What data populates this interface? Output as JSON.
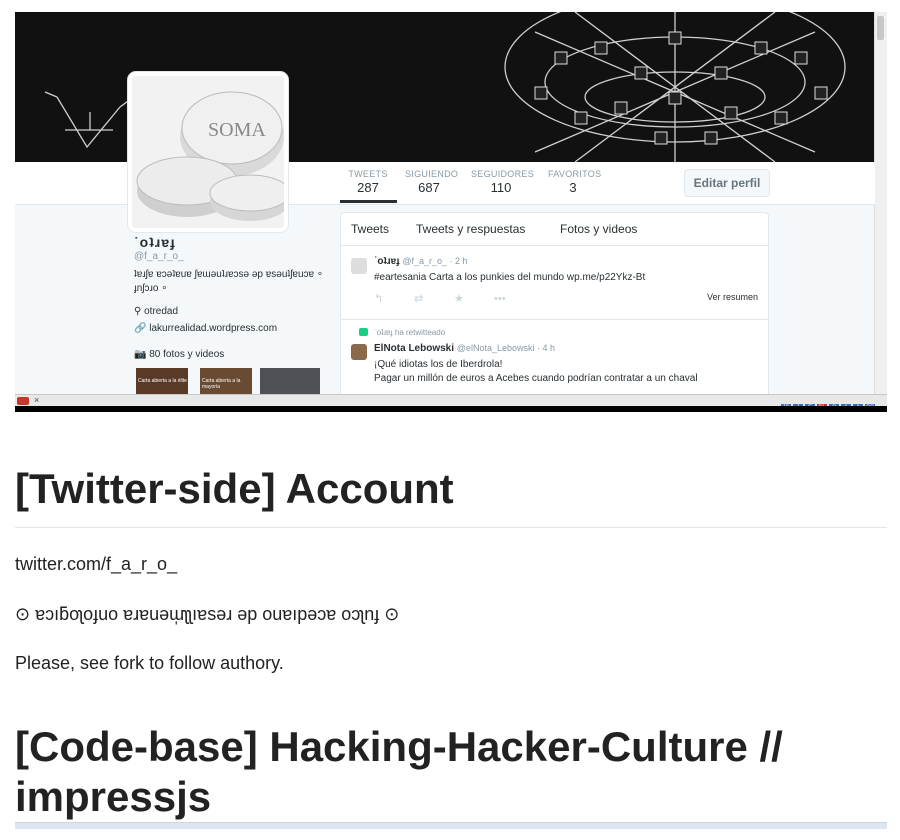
{
  "profile": {
    "name": "˙oʇɹɐɟ",
    "handle": "@f_a_r_o_",
    "bio": "ʇɐɹʃɐ ɐɔǝʇɐuɐ ʃɐɯǝuʇɹɐɔsǝ ǝp ɐsǝuʇʃɐuɔɐ ∘ ɟnʃɔɹo ∘",
    "location": "otredad",
    "link": "lakurrealidad.wordpress.com",
    "photos": "80 fotos y videos",
    "avatar_text": "SOMA",
    "edit_button": "Editar perfil"
  },
  "stats": [
    {
      "label": "TWEETS",
      "value": "287"
    },
    {
      "label": "SIGUIENDO",
      "value": "687"
    },
    {
      "label": "SEGUIDORES",
      "value": "110"
    },
    {
      "label": "FAVORITOS",
      "value": "3"
    }
  ],
  "thumbnails": [
    {
      "caption": "Carta abierta a la élite"
    },
    {
      "caption": "Carta abierta a la mayoría"
    }
  ],
  "timeline": {
    "tabs": [
      "Tweets",
      "Tweets y respuestas",
      "Fotos y videos"
    ],
    "tweet1": {
      "name": "˙oʇɹɐɟ",
      "meta": "@f_a_r_o_ · 2 h",
      "text": "#eartesania Carta a los punkies del mundo wp.me/p22Ykz-Bt",
      "summary": "Ver resumen"
    },
    "tweet2": {
      "retweet_line": "˙oʇɹɐɟ ha retwitteado",
      "name": "ElNota Lebowski",
      "meta": "@elNota_Lebowski · 4 h",
      "text1": "¡Qué idiotas los de Iberdrola!",
      "text2": "Pagar un millón de euros a Acebes cuando podrían contratar a un chaval"
    }
  },
  "statusbar_icons": [
    "JS",
    "J",
    "F",
    "SL",
    "C",
    "1",
    "A",
    "CS"
  ],
  "markdown": {
    "heading1": "[Twitter-side] Account",
    "para1": "twitter.com/f_a_r_o_",
    "para2": "⊙ ɐɔıƃoʅoɟuo ɐɹɐuǝɯ̩ʅʅıɐsǝɹ ǝp ouɐıpǝɔɐ oɔʅnɟ ⊙",
    "para3": "Please, see fork to follow authory.",
    "heading2": "[Code-base] Hacking-Hacker-Culture // impressjs"
  }
}
